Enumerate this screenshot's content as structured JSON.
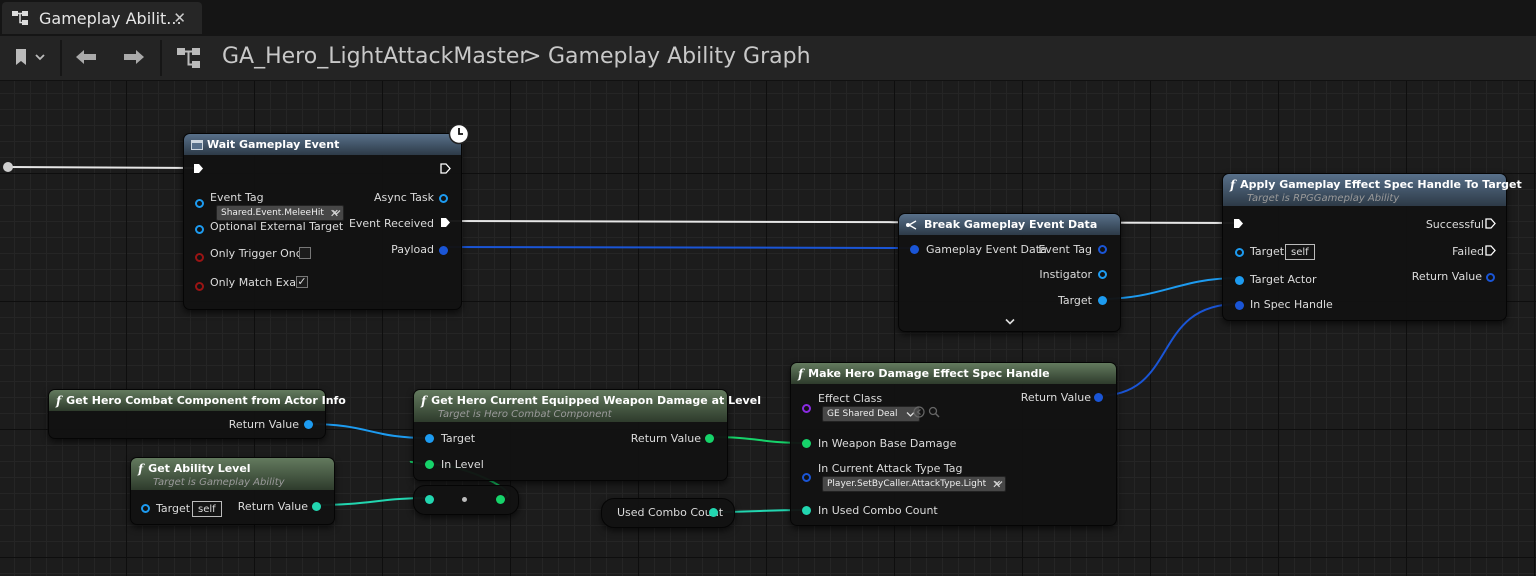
{
  "tab": {
    "title": "Gameplay Abilit...",
    "close": "✕"
  },
  "toolbar": {
    "bookmark_chevron": "⌄"
  },
  "breadcrumb": {
    "blueprint": "GA_Hero_LightAttackMaster",
    "separator": ">",
    "graph": "Gameplay Ability Graph"
  },
  "nodes": {
    "wait_event": {
      "title": "Wait Gameplay Event",
      "event_tag_label": "Event Tag",
      "event_tag_value": "Shared.Event.MeleeHit",
      "optional_target": "Optional External Target",
      "only_trigger_once": "Only Trigger Once",
      "only_match_exact": "Only Match Exact",
      "only_match_exact_check": "✓",
      "async_task": "Async Task",
      "event_received": "Event Received",
      "payload": "Payload"
    },
    "break_event": {
      "title": "Break Gameplay Event Data",
      "input": "Gameplay Event Data",
      "event_tag": "Event Tag",
      "instigator": "Instigator",
      "target": "Target"
    },
    "apply_effect": {
      "title": "Apply Gameplay Effect Spec Handle To Target",
      "subtitle": "Target is RPGGameplay Ability",
      "target": "Target",
      "target_value": "self",
      "target_actor": "Target Actor",
      "in_spec_handle": "In Spec Handle",
      "successful": "Successful",
      "failed": "Failed",
      "return_value": "Return Value"
    },
    "make_spec": {
      "title": "Make Hero Damage Effect Spec Handle",
      "effect_class": "Effect Class",
      "effect_class_value": "GE Shared Deal",
      "in_weapon_damage": "In Weapon Base Damage",
      "in_attack_tag": "In Current Attack Type Tag",
      "attack_tag_value": "Player.SetByCaller.AttackType.Light",
      "in_combo_count": "In Used Combo Count",
      "return_value": "Return Value"
    },
    "get_combat": {
      "title": "Get Hero Combat Component from Actor Info",
      "return_value": "Return Value"
    },
    "get_weapon_damage": {
      "title": "Get Hero Current Equipped Weapon Damage at Level",
      "subtitle": "Target is Hero Combat Component",
      "target": "Target",
      "in_level": "In Level",
      "return_value": "Return Value"
    },
    "get_ability_level": {
      "title": "Get Ability Level",
      "subtitle": "Target is Gameplay Ability",
      "target": "Target",
      "target_value": "self",
      "return_value": "Return Value"
    },
    "used_combo": {
      "title": "Used Combo Count"
    }
  },
  "colors": {
    "exec": "#ffffff",
    "object_pin": "#1d9bf0",
    "struct_pin": "#1a55d6",
    "float_pin": "#16d36a",
    "int_pin": "#22d6b0",
    "class_pin": "#8a2be2",
    "bool_pin": "#9a1414"
  }
}
